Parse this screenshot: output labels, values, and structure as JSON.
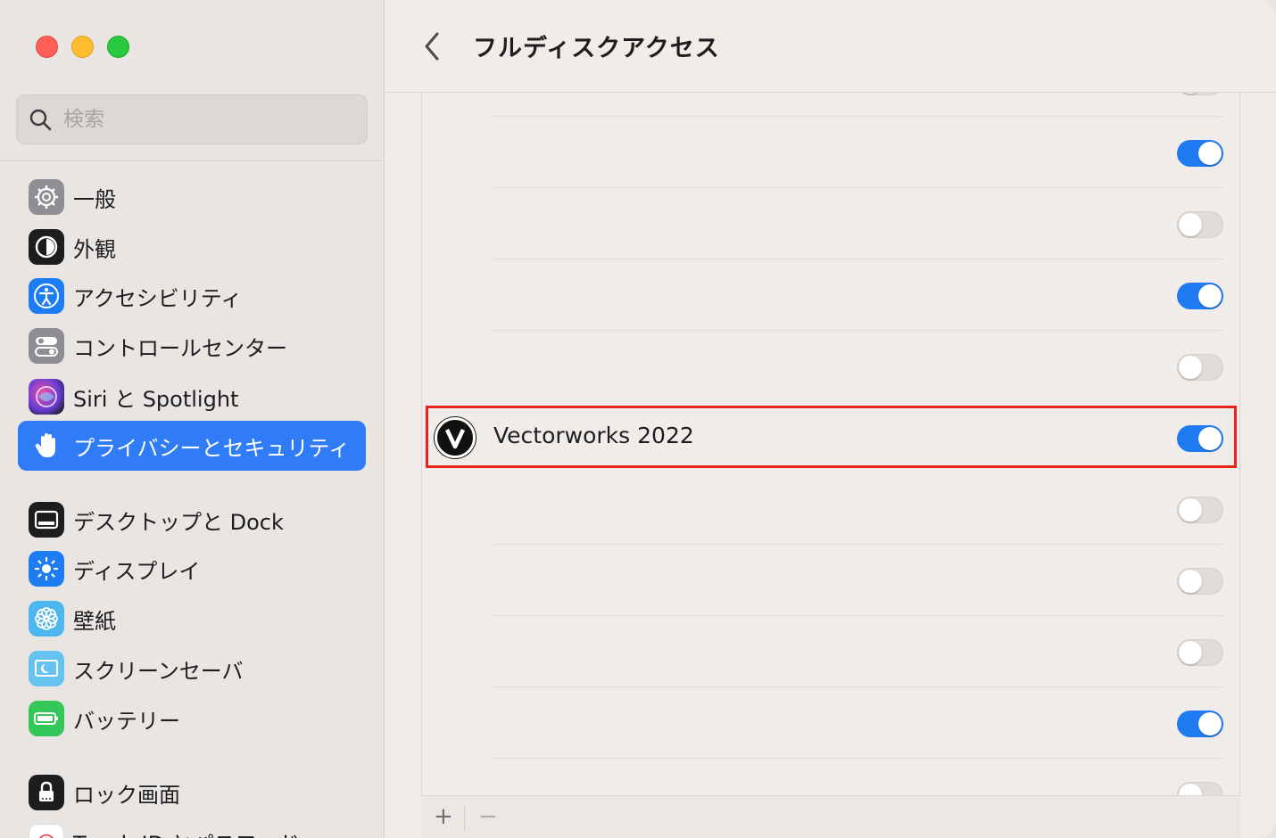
{
  "window": {
    "title": "フルディスクアクセス"
  },
  "search": {
    "placeholder": "検索"
  },
  "sidebar": {
    "items": [
      {
        "label": "一般",
        "icon": "gear-icon",
        "color": "#8e8e93"
      },
      {
        "label": "外観",
        "icon": "appearance-icon",
        "color": "#1d1d1f"
      },
      {
        "label": "アクセシビリティ",
        "icon": "accessibility-icon",
        "color": "#1e7cf2"
      },
      {
        "label": "コントロールセンター",
        "icon": "control-center-icon",
        "color": "#8e8e93"
      },
      {
        "label": "Siri と Spotlight",
        "icon": "siri-icon",
        "color": "#6a3cd8"
      },
      {
        "label": "プライバシーとセキュリティ",
        "icon": "hand-icon",
        "color": "#2f7cf6",
        "active": true
      },
      {
        "label": "デスクトップと Dock",
        "icon": "dock-icon",
        "color": "#1d1d1f"
      },
      {
        "label": "ディスプレイ",
        "icon": "sun-icon",
        "color": "#1e7cf2"
      },
      {
        "label": "壁紙",
        "icon": "flower-icon",
        "color": "#4fb7f0"
      },
      {
        "label": "スクリーンセーバ",
        "icon": "screensaver-icon",
        "color": "#66c3f0"
      },
      {
        "label": "バッテリー",
        "icon": "battery-icon",
        "color": "#33c759"
      },
      {
        "label": "ロック画面",
        "icon": "lock-icon",
        "color": "#1d1d1f"
      },
      {
        "label": "Touch ID とパスワード",
        "icon": "fingerprint-icon",
        "color": "#e8445a"
      }
    ]
  },
  "main": {
    "rows": [
      {
        "name": "",
        "enabled": false
      },
      {
        "name": "",
        "enabled": true
      },
      {
        "name": "",
        "enabled": false
      },
      {
        "name": "",
        "enabled": true
      },
      {
        "name": "",
        "enabled": false
      },
      {
        "name": "Vectorworks 2022",
        "enabled": true,
        "highlighted": true
      },
      {
        "name": "",
        "enabled": false
      },
      {
        "name": "",
        "enabled": false
      },
      {
        "name": "",
        "enabled": false
      },
      {
        "name": "",
        "enabled": true
      },
      {
        "name": "",
        "enabled": false
      }
    ],
    "footer": {
      "add_label": "+",
      "remove_label": "−"
    }
  },
  "colors": {
    "accent": "#1f7bf2",
    "highlight_border": "#e8241c"
  }
}
